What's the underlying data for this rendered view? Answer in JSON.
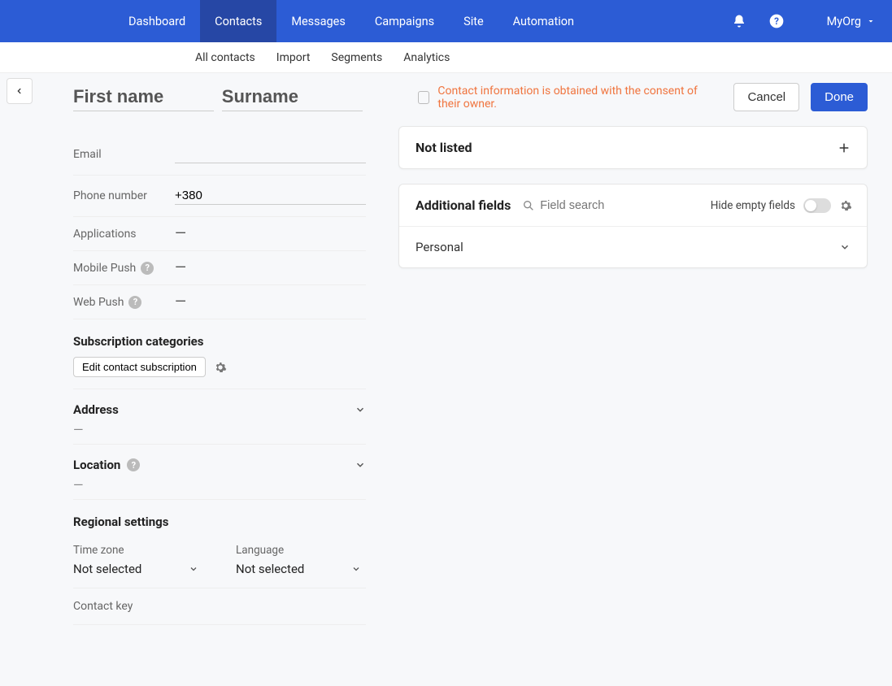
{
  "nav": {
    "items": [
      "Dashboard",
      "Contacts",
      "Messages",
      "Campaigns",
      "Site",
      "Automation"
    ],
    "active_index": 1,
    "org": "MyOrg"
  },
  "subnav": {
    "items": [
      "All contacts",
      "Import",
      "Segments",
      "Analytics"
    ]
  },
  "name": {
    "first_placeholder": "First name",
    "surname_placeholder": "Surname"
  },
  "fields": {
    "email_label": "Email",
    "phone_label": "Phone number",
    "phone_value": "+380",
    "applications_label": "Applications",
    "mobile_push_label": "Mobile Push",
    "web_push_label": "Web Push",
    "dash": "—"
  },
  "sub_cat": {
    "title": "Subscription categories",
    "edit_label": "Edit contact subscription"
  },
  "address": {
    "title": "Address",
    "dash": "—"
  },
  "location": {
    "title": "Location",
    "dash": "—"
  },
  "regional": {
    "title": "Regional settings",
    "tz_label": "Time zone",
    "lang_label": "Language",
    "not_selected": "Not selected"
  },
  "contact_key": {
    "label": "Contact key"
  },
  "consent": {
    "text": "Contact information is obtained with the consent of their owner."
  },
  "buttons": {
    "cancel": "Cancel",
    "done": "Done"
  },
  "not_listed": {
    "title": "Not listed"
  },
  "additional_fields": {
    "title": "Additional fields",
    "search_placeholder": "Field search",
    "hide_empty": "Hide empty fields",
    "personal": "Personal"
  }
}
